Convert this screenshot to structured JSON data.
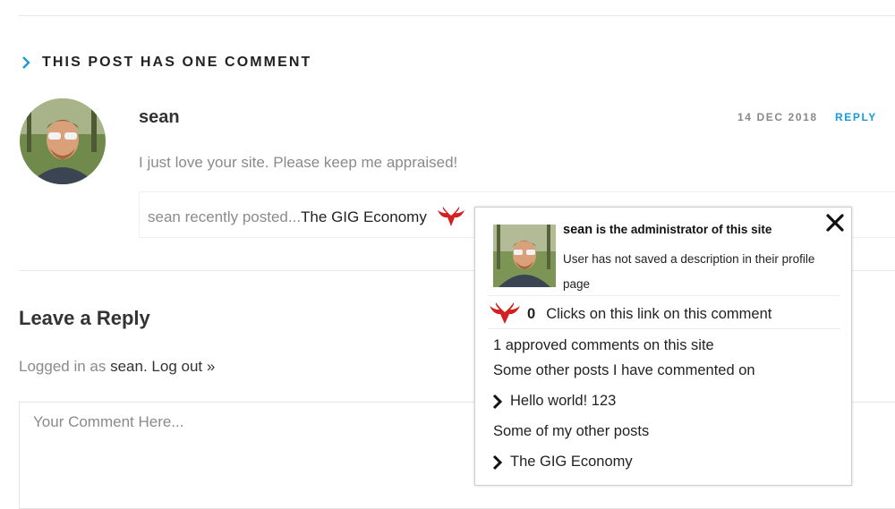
{
  "comments_section": {
    "title": "This Post Has One Comment"
  },
  "comment": {
    "author": "sean",
    "date": "14 DEC 2018",
    "reply_label": "REPLY",
    "text": "I just love your site. Please keep me appraised!",
    "recent_prefix": "sean recently posted...",
    "recent_post": "The GIG Economy"
  },
  "reply_form": {
    "title": "Leave a Reply",
    "logged_prefix": "Logged in as ",
    "logged_user": "sean",
    "logged_dot": ". ",
    "logout_label": "Log out »",
    "placeholder": "Your Comment Here..."
  },
  "popup": {
    "name": "sean",
    "role_text": " is the administrator of this site",
    "description": "User has not saved a description in their profile page",
    "clicks_count": "0",
    "clicks_text": "Clicks on this link on this comment",
    "approved_text": "1 approved comments on this site",
    "commented_heading": "Some other posts I have commented on",
    "commented_posts": [
      "Hello world! 123"
    ],
    "other_heading": "Some of my other posts",
    "other_posts": [
      "The GIG Economy"
    ]
  },
  "colors": {
    "accent": "#1a9ad6",
    "wings": "#d42020"
  },
  "icons": {
    "section_chevron": "chevron-right-icon",
    "wings": "commentluv-wings-icon",
    "close": "close-icon",
    "list_arrow": "chevron-right-icon"
  }
}
